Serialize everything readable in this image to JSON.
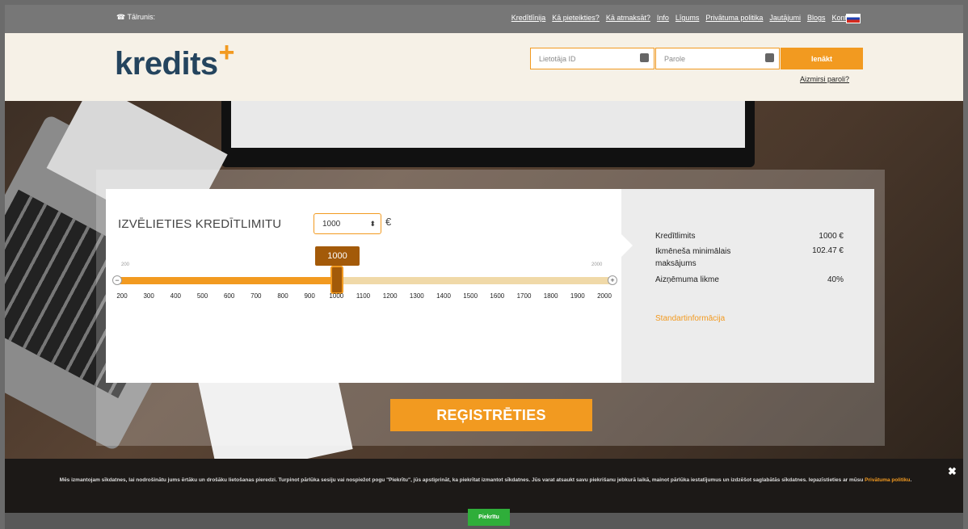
{
  "topbar": {
    "phone_label": "☎ Tālrunis:",
    "links": [
      "Kredītlīnija",
      "Kā pieteikties?",
      "Kā atmaksāt?",
      "Info",
      "Līgums",
      "Privātuma politika",
      "Jautājumi",
      "Blogs",
      "Kontakti"
    ]
  },
  "header": {
    "logo_text": "kredits",
    "logo_mark": "+",
    "user_placeholder": "Lietotāja ID",
    "password_placeholder": "Parole",
    "login_label": "Ienākt",
    "forgot_label": "Aizmirsi paroli?"
  },
  "calculator": {
    "title": "IZVĒLIETIES KREDĪTLIMITU",
    "selected_amount": "1000",
    "currency": "€",
    "tooltip_value": "1000",
    "min_small": "200",
    "max_small": "2000",
    "slider": {
      "min": 200,
      "max": 2000,
      "value": 1000
    },
    "ticks": [
      "200",
      "300",
      "400",
      "500",
      "600",
      "700",
      "800",
      "900",
      "1000",
      "1100",
      "1200",
      "1300",
      "1400",
      "1500",
      "1600",
      "1700",
      "1800",
      "1900",
      "2000"
    ]
  },
  "summary": {
    "rows": [
      {
        "label": "Kredītlimits",
        "value": "1000 €"
      },
      {
        "label": "Ikmēneša minimālais maksājums",
        "value": "102.47 €"
      },
      {
        "label": "Aizņēmuma likme",
        "value": "40%"
      }
    ],
    "standard_info": "Standartinformācija"
  },
  "register_label": "REĢISTRĒTIES",
  "cookie": {
    "text_main": "Mēs izmantojam sīkdatnes, lai nodrošinātu jums ērtāku un drošāku lietošanas pieredzi. Turpinot pārlūka sesiju vai nospiežot pogu \"Piekrītu\", jūs apstiprināt, ka piekrītat izmantot sīkdatnes. Jūs varat atsaukt savu piekrišanu jebkurā laikā, mainot pārlūka iestatījumus un izdzēšot saglabātās sīkdatnes. Iepazīstieties ar mūsu",
    "link_label": "Privātuma politiku",
    "close_glyph": "✖",
    "accept_label": "Piekrītu"
  },
  "colors": {
    "accent": "#f29a20",
    "accent_dark": "#a35a09",
    "logo": "#24445e",
    "accept": "#2fae3a"
  }
}
